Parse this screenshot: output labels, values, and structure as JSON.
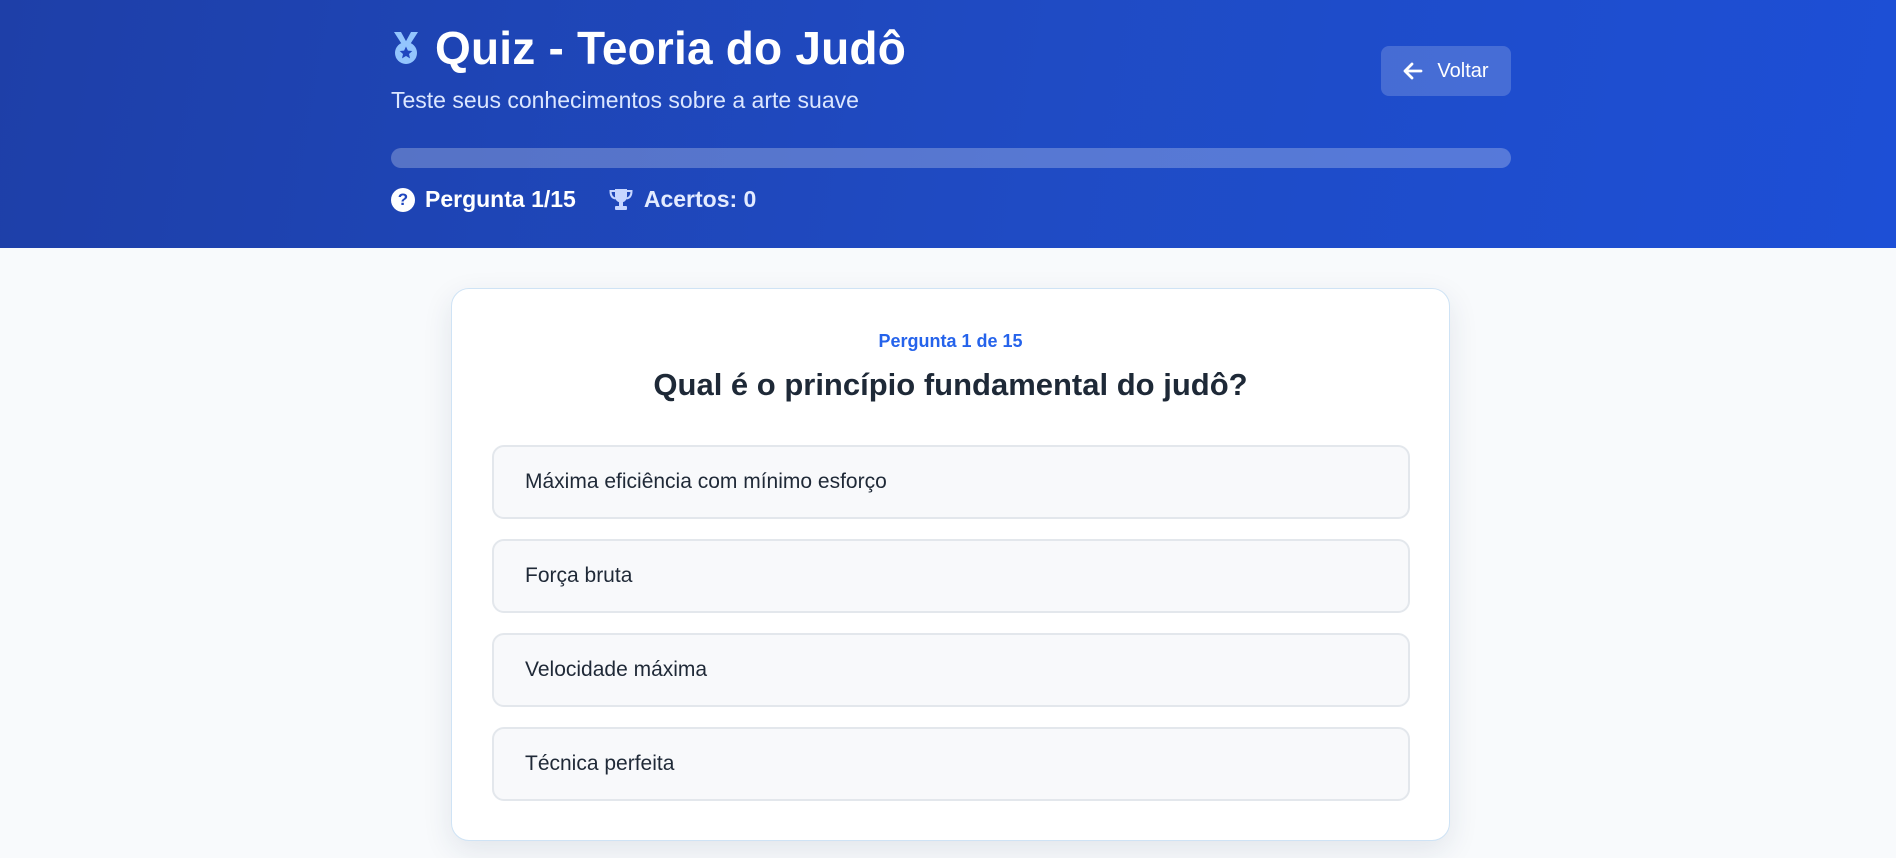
{
  "header": {
    "title": "Quiz - Teoria do Judô",
    "subtitle": "Teste seus conhecimentos sobre a arte suave",
    "back_label": "Voltar",
    "progress_fraction": 0,
    "question_stat": "Pergunta 1/15",
    "score_stat": "Acertos: 0",
    "icons": {
      "title": "medal-icon",
      "back": "arrow-left-icon",
      "question": "question-circle-icon",
      "score": "trophy-icon"
    }
  },
  "card": {
    "counter": "Pergunta 1 de 15",
    "question": "Qual é o princípio fundamental do judô?",
    "options": [
      "Máxima eficiência com mínimo esforço",
      "Força bruta",
      "Velocidade máxima",
      "Técnica perfeita"
    ]
  },
  "colors": {
    "header_gradient_start": "#1e3fa8",
    "header_gradient_end": "#1d4fd6",
    "accent": "#2563eb",
    "medal": "#93c5fd",
    "page_background": "#f8fafc"
  }
}
